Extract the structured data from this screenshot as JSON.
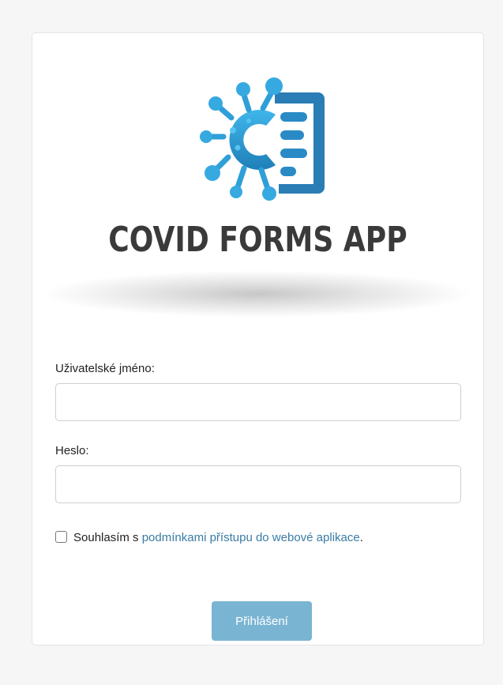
{
  "app": {
    "logo_text": "COVID FORMS APP",
    "brand_color": "#2f9fd8",
    "logo_icon": "virus-form-icon"
  },
  "form": {
    "username_label": "Uživatelské jméno:",
    "username_value": "",
    "password_label": "Heslo:",
    "password_value": "",
    "consent_prefix": "Souhlasím s ",
    "consent_link": "podmínkami přístupu do webové aplikace",
    "consent_suffix": ".",
    "consent_checked": false,
    "submit_label": "Přihlášení"
  },
  "colors": {
    "link": "#3a7ca5",
    "button": "#7ab4d3"
  }
}
